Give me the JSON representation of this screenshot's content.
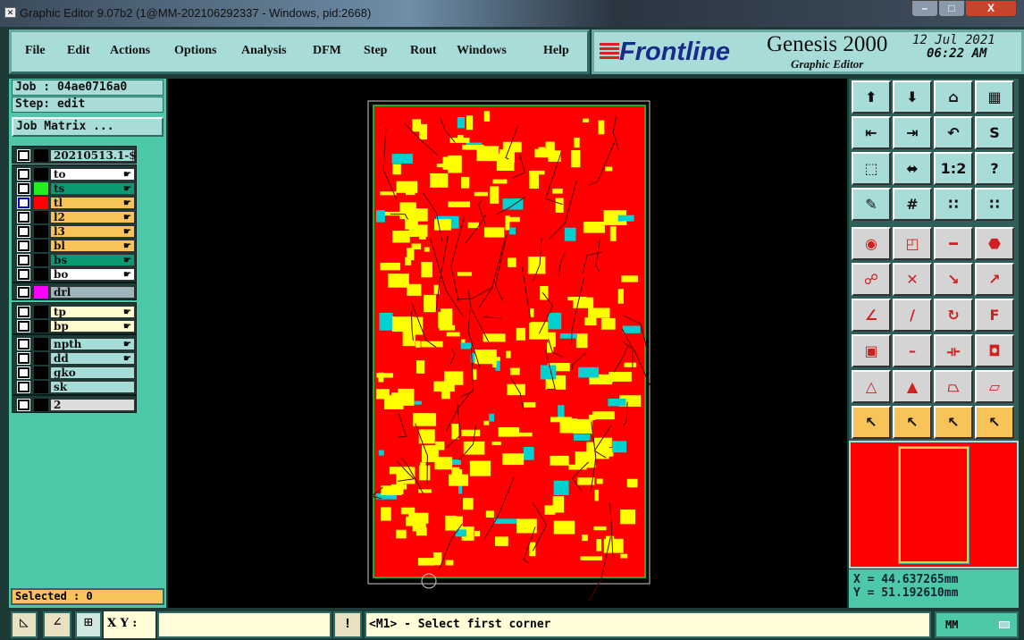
{
  "window": {
    "title": "Graphic Editor 9.07b2 (1@MM-202106292337 - Windows, pid:2668)",
    "minimize": "–",
    "maximize": "□",
    "close": "X"
  },
  "menu": [
    "File",
    "Edit",
    "Actions",
    "Options",
    "Analysis",
    "DFM",
    "Step",
    "Rout",
    "Windows",
    "Help"
  ],
  "logo": {
    "brand": "Frontline",
    "product": "Genesis 2000",
    "subtitle": "Graphic Editor",
    "date": "12 Jul 2021",
    "time": "06:22 AM"
  },
  "job": {
    "job": "Job : 04ae0716a0",
    "step": "Step: edit",
    "matrix_button": "Job Matrix ..."
  },
  "layers": [
    {
      "name": "20210513.1-$",
      "bg": "#a8dcd8",
      "swatch": "#000000",
      "hand": false,
      "group": 0
    },
    {
      "name": "to",
      "bg": "#ffffff",
      "swatch": "#000000",
      "hand": true,
      "group": 1
    },
    {
      "name": "ts",
      "bg": "#0b9a74",
      "swatch": "#22ee22",
      "hand": true,
      "group": 1
    },
    {
      "name": "tl",
      "bg": "#f8c45a",
      "swatch": "#ff0000",
      "hand": true,
      "group": 1,
      "active": true
    },
    {
      "name": "l2",
      "bg": "#f8c45a",
      "swatch": "#000000",
      "hand": true,
      "group": 1
    },
    {
      "name": "l3",
      "bg": "#f8c45a",
      "swatch": "#000000",
      "hand": true,
      "group": 1
    },
    {
      "name": "bl",
      "bg": "#f8c45a",
      "swatch": "#000000",
      "hand": true,
      "group": 1
    },
    {
      "name": "bs",
      "bg": "#0b9a74",
      "swatch": "#000000",
      "hand": true,
      "group": 1
    },
    {
      "name": "bo",
      "bg": "#ffffff",
      "swatch": "#000000",
      "hand": true,
      "group": 1
    },
    {
      "name": "drl",
      "bg": "#a0b4bc",
      "swatch": "#ff00ff",
      "hand": false,
      "group": 2
    },
    {
      "name": "tp",
      "bg": "#fffcd0",
      "swatch": "#000000",
      "hand": true,
      "group": 3
    },
    {
      "name": "bp",
      "bg": "#fffcd0",
      "swatch": "#000000",
      "hand": true,
      "group": 3
    },
    {
      "name": "npth",
      "bg": "#a8dcd8",
      "swatch": "#000000",
      "hand": true,
      "group": 4
    },
    {
      "name": "dd",
      "bg": "#a8dcd8",
      "swatch": "#000000",
      "hand": true,
      "group": 4
    },
    {
      "name": "gko",
      "bg": "#a8dcd8",
      "swatch": "#000000",
      "hand": false,
      "group": 4
    },
    {
      "name": "sk",
      "bg": "#a8dcd8",
      "swatch": "#000000",
      "hand": false,
      "group": 4
    },
    {
      "name": "2",
      "bg": "#dcdcdc",
      "swatch": "#000000",
      "hand": false,
      "group": 5
    }
  ],
  "tools": [
    {
      "name": "open-icon",
      "glyph": "⬆"
    },
    {
      "name": "save-icon",
      "glyph": "⬇"
    },
    {
      "name": "home-icon",
      "glyph": "⌂"
    },
    {
      "name": "window-split-icon",
      "glyph": "▦"
    },
    {
      "name": "import-icon",
      "glyph": "⇤"
    },
    {
      "name": "export-icon",
      "glyph": "⇥"
    },
    {
      "name": "undo-icon",
      "glyph": "↶"
    },
    {
      "name": "route-icon",
      "glyph": "S"
    },
    {
      "name": "zoom-fit-icon",
      "glyph": "⬚"
    },
    {
      "name": "zoom-pan-icon",
      "glyph": "⬌"
    },
    {
      "name": "scale-icon",
      "glyph": "1:2"
    },
    {
      "name": "help-icon",
      "glyph": "?"
    },
    {
      "name": "palette-icon",
      "glyph": "✎"
    },
    {
      "name": "grid-icon",
      "glyph": "#"
    },
    {
      "name": "netlist-top-icon",
      "glyph": "∷"
    },
    {
      "name": "netlist-bottom-icon",
      "glyph": "∷"
    },
    {
      "name": "pad-icon",
      "glyph": "◉"
    },
    {
      "name": "copy-shape-icon",
      "glyph": "◰"
    },
    {
      "name": "ruler-icon",
      "glyph": "━"
    },
    {
      "name": "octagon-pad-icon",
      "glyph": "⬣"
    },
    {
      "name": "connect-nodes-icon",
      "glyph": "☍"
    },
    {
      "name": "cross-icon",
      "glyph": "✕"
    },
    {
      "name": "link-open-icon",
      "glyph": "↘"
    },
    {
      "name": "link-filled-icon",
      "glyph": "↗"
    },
    {
      "name": "angle-icon",
      "glyph": "∠"
    },
    {
      "name": "line-split-icon",
      "glyph": "∕"
    },
    {
      "name": "arc-icon",
      "glyph": "↻"
    },
    {
      "name": "mirror-icon",
      "glyph": "F"
    },
    {
      "name": "move-pad-icon",
      "glyph": "▣"
    },
    {
      "name": "segment-icon",
      "glyph": "–"
    },
    {
      "name": "measure-icon",
      "glyph": "⟛"
    },
    {
      "name": "shapes-icon",
      "glyph": "◘"
    },
    {
      "name": "triangle-icon",
      "glyph": "△"
    },
    {
      "name": "arrow-up-triangle-icon",
      "glyph": "▲"
    },
    {
      "name": "trapezoid-icon",
      "glyph": "⏢"
    },
    {
      "name": "trapezoid-line-icon",
      "glyph": "⏥"
    },
    {
      "name": "select-arrow-icon",
      "glyph": "↖"
    },
    {
      "name": "select-box-icon",
      "glyph": "↖"
    },
    {
      "name": "select-polygon-icon",
      "glyph": "↖"
    },
    {
      "name": "select-net-icon",
      "glyph": "↖"
    }
  ],
  "coords": {
    "x": "X = 44.637265mm",
    "y": "Y = 51.192610mm"
  },
  "selected": "Selected : 0",
  "bottom": {
    "xy_label": "X Y :",
    "xy_value": "",
    "prompt": "<M1> - Select first corner",
    "units": "MM",
    "info_button": "!"
  }
}
